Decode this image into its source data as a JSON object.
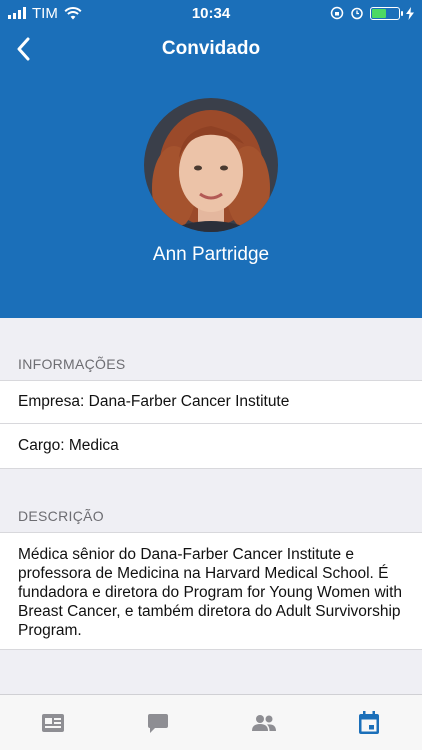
{
  "status_bar": {
    "carrier": "TIM",
    "time": "10:34",
    "battery_level": 0.55
  },
  "nav": {
    "title": "Convidado",
    "back_icon": "chevron-left-icon"
  },
  "profile": {
    "name": "Ann Partridge"
  },
  "info": {
    "header": "INFORMAÇÕES",
    "company": "Empresa: Dana-Farber Cancer Institute",
    "role": "Cargo: Medica"
  },
  "description": {
    "header": "DESCRIÇÃO",
    "text": "Médica sênior do Dana-Farber Cancer Institute e professora de Medicina na Harvard Medical School. É fundadora e diretora do Program for Young Women with Breast Cancer, e também diretora do Adult Survivorship Program."
  },
  "tabs": [
    {
      "icon": "news-icon",
      "active": false
    },
    {
      "icon": "chat-icon",
      "active": false
    },
    {
      "icon": "people-icon",
      "active": false
    },
    {
      "icon": "calendar-icon",
      "active": true
    }
  ],
  "colors": {
    "brand_blue": "#1b6fb9",
    "tab_inactive": "#8e8e93",
    "tab_active": "#1b6fb9",
    "battery_green": "#4cd964"
  }
}
